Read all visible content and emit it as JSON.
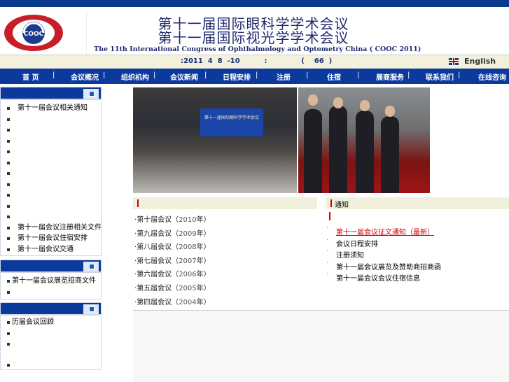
{
  "header": {
    "title_line1": "第十一届国际眼科学学术会议",
    "title_line2": "第十一届国际视光学学术会议",
    "title_en": "The 11th International Congress of Ophthalmology  and Optometry China ( COOC 2011)",
    "logo_text": "COOC"
  },
  "infobar": {
    "date": ":2011  4  8  -10          :              (    66  )",
    "language": "English"
  },
  "nav": [
    "首 页",
    "会议概况",
    "组织机构",
    "会议新闻",
    "日程安排",
    "注册",
    "住宿",
    "展商服务",
    "联系我们",
    "在线咨询"
  ],
  "sidebar": {
    "box1_items": [
      "第十一届会议相关通知",
      "",
      "",
      "",
      "",
      "",
      "",
      "",
      "",
      "",
      "",
      "第十一届会议注册相关文件",
      "第十一届会议住宿安排",
      "第十一届会议交通"
    ],
    "box2_items": [
      "第十一届会议展览招商文件",
      ""
    ],
    "box3_items": [
      "历届会议回顾",
      "",
      "",
      ""
    ]
  },
  "photos": {
    "screen_text": "第十一届国际眼科学学术会议"
  },
  "news": {
    "items": [
      {
        "pre": "第十届会议（",
        "year": "2010",
        "post": "年）"
      },
      {
        "pre": "第九届会议（",
        "year": "2009",
        "post": "年）"
      },
      {
        "pre": "第八届会议（",
        "year": "2008",
        "post": "年）"
      },
      {
        "pre": "第七届会议（",
        "year": "2007",
        "post": "年）"
      },
      {
        "pre": "第六届会议（",
        "year": "2006",
        "post": "年）"
      },
      {
        "pre": "第五届会议（",
        "year": "2005",
        "post": "年）"
      },
      {
        "pre": "第四届会议（",
        "year": "2004",
        "post": "年）"
      }
    ]
  },
  "right": {
    "section_title": "通知",
    "items": [
      "第十一届会议征文通知（最新）",
      "会议日程安排",
      "注册须知",
      "第十一届会议展览及赞助商招商函",
      "第十一届会议会议住宿信息"
    ]
  },
  "colors": {
    "nav_blue": "#0b3a9c",
    "accent_red": "#d00000"
  }
}
